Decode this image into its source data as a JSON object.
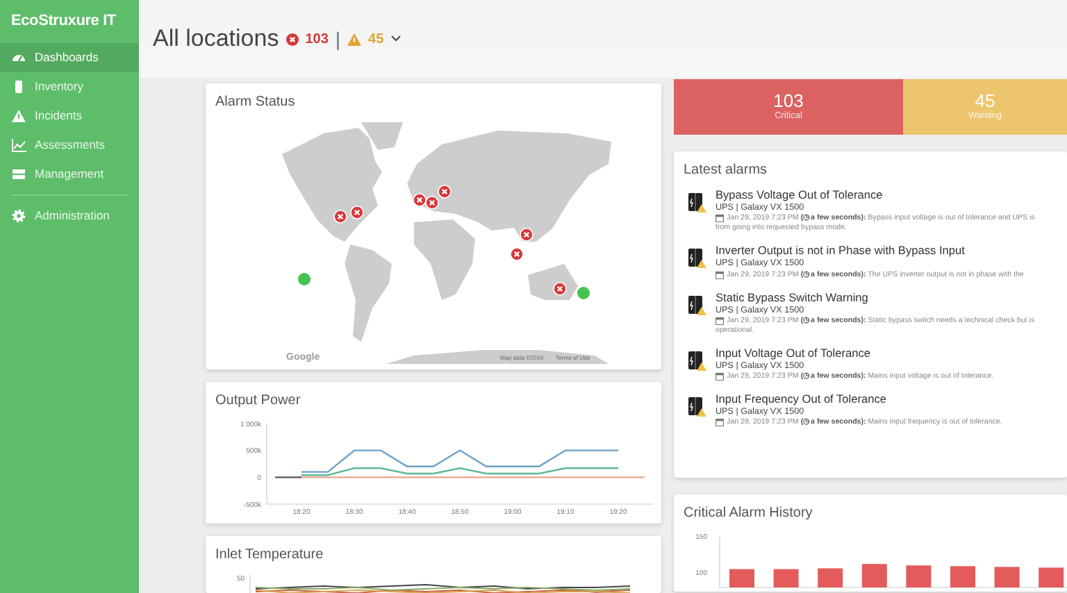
{
  "sidebar": {
    "logo": "EcoStruxure IT",
    "items": [
      {
        "label": "Dashboards",
        "selected": true
      },
      {
        "label": "Inventory",
        "selected": false
      },
      {
        "label": "Incidents",
        "selected": false
      },
      {
        "label": "Assessments",
        "selected": false
      },
      {
        "label": "Management",
        "selected": false
      },
      {
        "label": "Administration",
        "selected": false
      }
    ]
  },
  "header": {
    "title": "All locations",
    "critical_count": "103",
    "separator": "|",
    "warning_count": "45"
  },
  "alarm_status": {
    "title": "Alarm Status",
    "markers": [
      {
        "kind": "critical"
      },
      {
        "kind": "critical"
      },
      {
        "kind": "critical"
      },
      {
        "kind": "critical"
      },
      {
        "kind": "critical"
      },
      {
        "kind": "critical"
      },
      {
        "kind": "critical"
      },
      {
        "kind": "critical"
      },
      {
        "kind": "ok"
      },
      {
        "kind": "ok"
      }
    ],
    "map_logo": "Google",
    "map_credit": "Map data ©2019",
    "terms": "Terms of Use"
  },
  "output_power": {
    "title": "Output Power",
    "chart_data": {
      "type": "line",
      "categories": [
        null,
        "18:20",
        null,
        "18:30",
        null,
        "18:40",
        null,
        "18:50",
        null,
        "19:00",
        null,
        "19:10",
        null,
        "19:20",
        null
      ],
      "ylim": [
        -500,
        1000
      ],
      "yticks": [
        {
          "value": -500,
          "label": "-500k"
        },
        {
          "value": 0,
          "label": "0"
        },
        {
          "value": 500,
          "label": "500k"
        },
        {
          "value": 1000,
          "label": "1 000k"
        }
      ],
      "series": [
        {
          "color": "#6a9fc4",
          "values": [
            null,
            100,
            100,
            500,
            500,
            200,
            200,
            500,
            200,
            200,
            200,
            500,
            500,
            500,
            null
          ]
        },
        {
          "color": "#5cb89a",
          "values": [
            null,
            40,
            40,
            170,
            170,
            70,
            70,
            170,
            70,
            70,
            70,
            170,
            170,
            170,
            null
          ]
        },
        {
          "color": "#e8a58a",
          "values": [
            null,
            0,
            0,
            0,
            0,
            0,
            0,
            0,
            0,
            0,
            0,
            0,
            0,
            0,
            0
          ]
        },
        {
          "color": "#555555",
          "values": [
            0,
            0,
            null,
            null,
            null,
            null,
            null,
            null,
            null,
            null,
            null,
            null,
            null,
            null,
            null
          ]
        }
      ]
    }
  },
  "inlet_temperature": {
    "title": "Inlet Temperature",
    "tick": "50"
  },
  "summary": [
    {
      "kind": "critical",
      "count": "103",
      "label": "Critical"
    },
    {
      "kind": "warning",
      "count": "45",
      "label": "Warning"
    }
  ],
  "latest_alarms": {
    "title": "Latest alarms",
    "items": [
      {
        "title": "Bypass Voltage Out of Tolerance",
        "device": "UPS | Galaxy VX 1500",
        "detail": "Jan 29, 2019 7:23 PM **(◷ a few seconds):** Bypass input voltage is out of tolerance and UPS is",
        "continuation": "from going into requested bypass mode."
      },
      {
        "title": "Inverter Output is not in Phase with Bypass Input",
        "device": "UPS | Galaxy VX 1500",
        "detail": "Jan 29, 2019 7:23 PM **(◷ a few seconds):** The UPS inverter output is not in phase with the"
      },
      {
        "title": "Static Bypass Switch Warning",
        "device": "UPS | Galaxy VX 1500",
        "detail": "Jan 29, 2019 7:23 PM **(◷ a few seconds):** Static bypass switch needs a technical check but is",
        "continuation": "operational."
      },
      {
        "title": "Input Voltage Out of Tolerance",
        "device": "UPS | Galaxy VX 1500",
        "detail": "Jan 29, 2019 7:23 PM **(◷ a few seconds):** Mains input voltage is out of tolerance."
      },
      {
        "title": "Input Frequency Out of Tolerance",
        "device": "UPS | Galaxy VX 1500",
        "detail": "Jan 29, 2019 7:23 PM **(◷ a few seconds):** Mains input frequency is out of tolerance."
      }
    ]
  },
  "critical_history": {
    "title": "Critical Alarm History",
    "chart_data": {
      "type": "bar",
      "categories": [
        null,
        null,
        null,
        null,
        null,
        null,
        null,
        null
      ],
      "values": [
        105,
        105,
        106,
        112,
        110,
        109,
        108,
        107
      ],
      "ylim": [
        80,
        150
      ],
      "yticks": [
        {
          "value": 100,
          "label": "100"
        },
        {
          "value": 150,
          "label": "150"
        }
      ]
    }
  }
}
